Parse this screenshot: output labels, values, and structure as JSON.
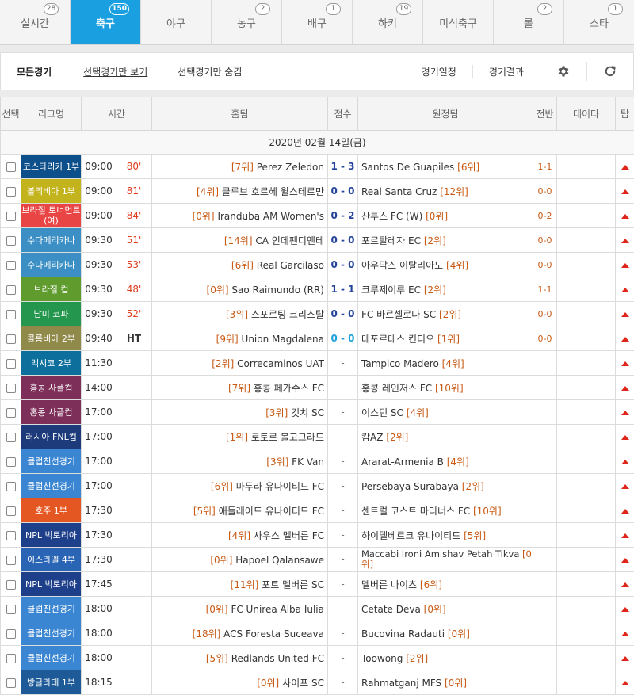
{
  "tabs": [
    {
      "label": "실시간",
      "count": "28",
      "active": false
    },
    {
      "label": "축구",
      "count": "150",
      "active": true
    },
    {
      "label": "야구",
      "count": "",
      "active": false
    },
    {
      "label": "농구",
      "count": "2",
      "active": false
    },
    {
      "label": "배구",
      "count": "1",
      "active": false
    },
    {
      "label": "하키",
      "count": "19",
      "active": false
    },
    {
      "label": "미식축구",
      "count": "",
      "active": false
    },
    {
      "label": "롤",
      "count": "2",
      "active": false
    },
    {
      "label": "스타",
      "count": "1",
      "active": false
    }
  ],
  "filter": {
    "all": "모든경기",
    "show_selected": "선택경기만 보기",
    "hide_selected": "선택경기만 숨김",
    "schedule": "경기일정",
    "results": "경기결과",
    "settings_icon": "gear-icon",
    "refresh_icon": "refresh-icon"
  },
  "headers": {
    "select": "선택",
    "league": "리그명",
    "time": "시간",
    "home": "홈팀",
    "score": "점수",
    "away": "원정팀",
    "half": "전반",
    "data": "데이타",
    "tip": "탑"
  },
  "date_label": "2020년 02월 14일(금)",
  "colors": {
    "accent": "#1aa0e0",
    "score_blue": "#24439a",
    "minute_red": "#e03c1e",
    "rank_orange": "#c85a14",
    "tip_red": "#e0251b"
  },
  "matches": [
    {
      "league": "코스타리카 1부",
      "league_color": "#0d4f8b",
      "time": "09:00",
      "minute": "80'",
      "home_rank": "[7위]",
      "home": "Perez Zeledon",
      "score": "1 - 3",
      "away": "Santos De Guapiles",
      "away_rank": "[6위]",
      "half": "1-1"
    },
    {
      "league": "볼리비아 1부",
      "league_color": "#c3b41d",
      "time": "09:00",
      "minute": "81'",
      "home_rank": "[4위]",
      "home": "클루브 호르헤 윌스테르만",
      "score": "0 - 0",
      "away": "Real Santa Cruz",
      "away_rank": "[12위]",
      "half": "0-0"
    },
    {
      "league": "브라질 토너먼트(여)",
      "league_color": "#e94545",
      "time": "09:00",
      "minute": "84'",
      "home_rank": "[0위]",
      "home": "Iranduba AM Women's",
      "score": "0 - 2",
      "away": "산투스 FC (W)",
      "away_rank": "[0위]",
      "half": "0-2"
    },
    {
      "league": "수다메리카나",
      "league_color": "#3b8fc4",
      "time": "09:30",
      "minute": "51'",
      "home_rank": "[14위]",
      "home": "CA 인데펜디엔테",
      "score": "0 - 0",
      "away": "포르탈레자 EC",
      "away_rank": "[2위]",
      "half": "0-0"
    },
    {
      "league": "수다메리카나",
      "league_color": "#3b8fc4",
      "time": "09:30",
      "minute": "53'",
      "home_rank": "[6위]",
      "home": "Real Garcilaso",
      "score": "0 - 0",
      "away": "아우닥스 이탈리아노",
      "away_rank": "[4위]",
      "half": "0-0"
    },
    {
      "league": "브라질 컵",
      "league_color": "#5f9b2d",
      "time": "09:30",
      "minute": "48'",
      "home_rank": "[0위]",
      "home": "Sao Raimundo (RR)",
      "score": "1 - 1",
      "away": "크루제이루 EC",
      "away_rank": "[2위]",
      "half": "1-1"
    },
    {
      "league": "남미 코파",
      "league_color": "#25964d",
      "time": "09:30",
      "minute": "52'",
      "home_rank": "[3위]",
      "home": "스포르팅 크리스탈",
      "score": "0 - 0",
      "away": "FC 바르셀로나 SC",
      "away_rank": "[2위]",
      "half": "0-0"
    },
    {
      "league": "콜롬비아 2부",
      "league_color": "#8f8a4a",
      "time": "09:40",
      "minute": "HT",
      "home_rank": "[9위]",
      "home": "Union Magdalena",
      "score": "0 - 0",
      "away": "데포르테스 킨디오",
      "away_rank": "[1위]",
      "half": "0-0"
    },
    {
      "league": "멕시코 2부",
      "league_color": "#0d6f9c",
      "time": "11:30",
      "minute": "",
      "home_rank": "[2위]",
      "home": "Correcaminos UAT",
      "score": "-",
      "away": "Tampico Madero",
      "away_rank": "[4위]",
      "half": ""
    },
    {
      "league": "홍콩 사플컵",
      "league_color": "#7d2f59",
      "time": "14:00",
      "minute": "",
      "home_rank": "[7위]",
      "home": "홍콩 페가수스 FC",
      "score": "-",
      "away": "홍콩 레인저스 FC",
      "away_rank": "[10위]",
      "half": ""
    },
    {
      "league": "홍콩 사플컵",
      "league_color": "#7d2f59",
      "time": "17:00",
      "minute": "",
      "home_rank": "[3위]",
      "home": "킷치 SC",
      "score": "-",
      "away": "이스턴 SC",
      "away_rank": "[4위]",
      "half": ""
    },
    {
      "league": "러시아 FNL컵",
      "league_color": "#1d3a7a",
      "time": "17:00",
      "minute": "",
      "home_rank": "[1위]",
      "home": "로토르 볼고그라드",
      "score": "-",
      "away": "캄AZ",
      "away_rank": "[2위]",
      "half": ""
    },
    {
      "league": "클럽친선경기",
      "league_color": "#3b86d2",
      "time": "17:00",
      "minute": "",
      "home_rank": "[3위]",
      "home": "FK Van",
      "score": "-",
      "away": "Ararat-Armenia B",
      "away_rank": "[4위]",
      "half": ""
    },
    {
      "league": "클럽친선경기",
      "league_color": "#3b86d2",
      "time": "17:00",
      "minute": "",
      "home_rank": "[6위]",
      "home": "마두라 유나이티드 FC",
      "score": "-",
      "away": "Persebaya Surabaya",
      "away_rank": "[2위]",
      "half": ""
    },
    {
      "league": "호주 1부",
      "league_color": "#e55722",
      "time": "17:30",
      "minute": "",
      "home_rank": "[5위]",
      "home": "애들레이드 유나이티드 FC",
      "score": "-",
      "away": "센트럴 코스트 마리너스 FC",
      "away_rank": "[10위]",
      "half": ""
    },
    {
      "league": "NPL 빅토리아",
      "league_color": "#1e3f8a",
      "time": "17:30",
      "minute": "",
      "home_rank": "[4위]",
      "home": "사우스 멜버른 FC",
      "score": "-",
      "away": "하이델베르크 유나이티드",
      "away_rank": "[5위]",
      "half": ""
    },
    {
      "league": "이스라엘 4부",
      "league_color": "#2a64b4",
      "time": "17:30",
      "minute": "",
      "home_rank": "[0위]",
      "home": "Hapoel Qalansawe",
      "score": "-",
      "away": "Maccabi Ironi Amishav Petah Tikva",
      "away_rank": "[0위]",
      "half": "",
      "wrap": true
    },
    {
      "league": "NPL 빅토리아",
      "league_color": "#1e3f8a",
      "time": "17:45",
      "minute": "",
      "home_rank": "[11위]",
      "home": "포트 멜버른 SC",
      "score": "-",
      "away": "멜버른 나이츠",
      "away_rank": "[6위]",
      "half": ""
    },
    {
      "league": "클럽친선경기",
      "league_color": "#3b86d2",
      "time": "18:00",
      "minute": "",
      "home_rank": "[0위]",
      "home": "FC Unirea Alba Iulia",
      "score": "-",
      "away": "Cetate Deva",
      "away_rank": "[0위]",
      "half": ""
    },
    {
      "league": "클럽친선경기",
      "league_color": "#3b86d2",
      "time": "18:00",
      "minute": "",
      "home_rank": "[18위]",
      "home": "ACS Foresta Suceava",
      "score": "-",
      "away": "Bucovina Radauti",
      "away_rank": "[0위]",
      "half": ""
    },
    {
      "league": "클럽친선경기",
      "league_color": "#3b86d2",
      "time": "18:00",
      "minute": "",
      "home_rank": "[5위]",
      "home": "Redlands United FC",
      "score": "-",
      "away": "Toowong",
      "away_rank": "[2위]",
      "half": ""
    },
    {
      "league": "방글라데 1부",
      "league_color": "#1d5a97",
      "time": "18:15",
      "minute": "",
      "home_rank": "[0위]",
      "home": "사이프 SC",
      "score": "-",
      "away": "Rahmatganj MFS",
      "away_rank": "[0위]",
      "half": ""
    }
  ]
}
